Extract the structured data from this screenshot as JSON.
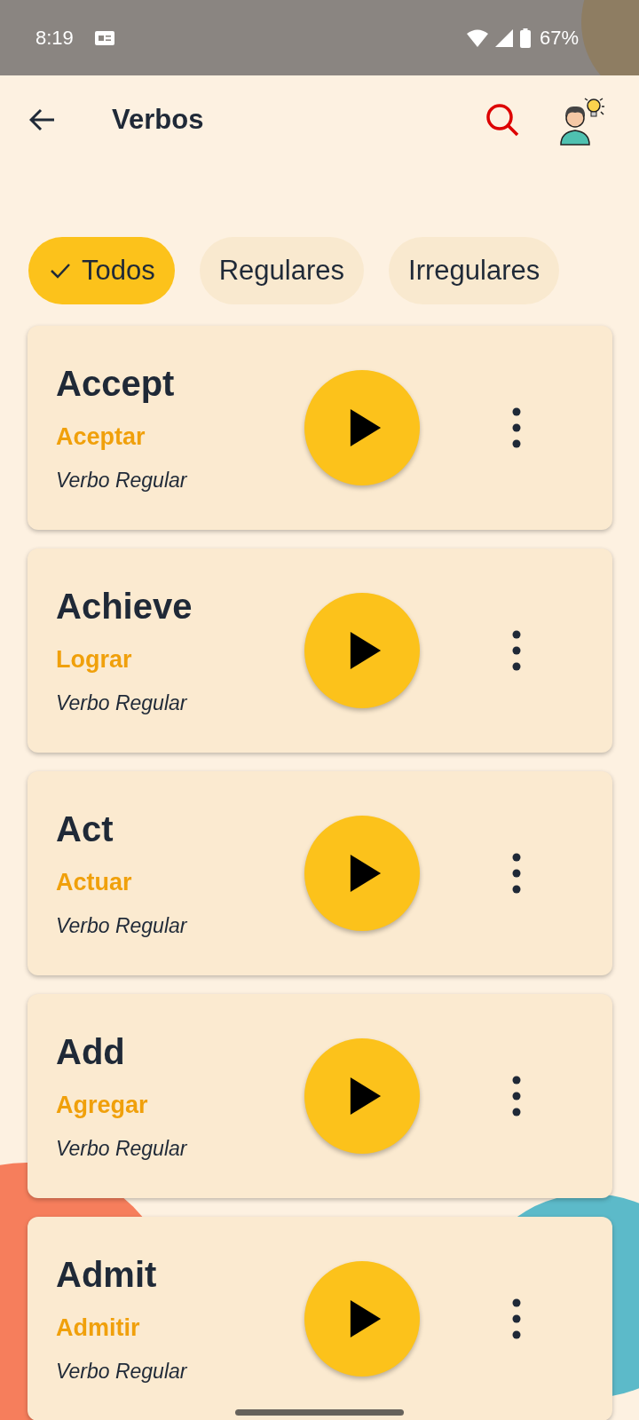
{
  "status_bar": {
    "time": "8:19",
    "battery": "67%"
  },
  "header": {
    "title": "Verbos"
  },
  "filters": [
    {
      "label": "Todos",
      "selected": true
    },
    {
      "label": "Regulares",
      "selected": false
    },
    {
      "label": "Irregulares",
      "selected": false
    }
  ],
  "verbs": [
    {
      "word": "Accept",
      "translation": "Aceptar",
      "type": "Verbo Regular"
    },
    {
      "word": "Achieve",
      "translation": "Lograr",
      "type": "Verbo Regular"
    },
    {
      "word": "Act",
      "translation": "Actuar",
      "type": "Verbo Regular"
    },
    {
      "word": "Add",
      "translation": "Agregar",
      "type": "Verbo Regular"
    },
    {
      "word": "Admit",
      "translation": "Admitir",
      "type": "Verbo Regular"
    }
  ]
}
